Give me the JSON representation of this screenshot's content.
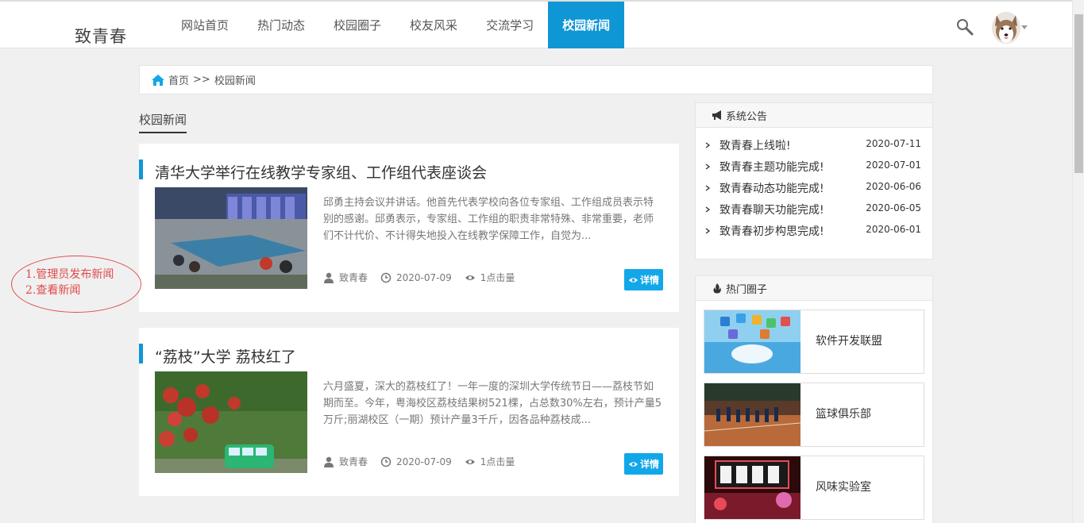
{
  "header": {
    "logo": "致青春",
    "nav": [
      "网站首页",
      "热门动态",
      "校园圈子",
      "校友风采",
      "交流学习",
      "校园新闻"
    ],
    "active_index": 5,
    "accent_color": "#0f96d5"
  },
  "breadcrumb": {
    "home": "首页",
    "separator": ">>",
    "current": "校园新闻"
  },
  "section": {
    "title": "校园新闻"
  },
  "news": [
    {
      "title": "清华大学举行在线教学专家组、工作组代表座谈会",
      "text": "邱勇主持会议并讲话。他首先代表学校向各位专家组、工作组成员表示特别的感谢。邱勇表示，专家组、工作组的职责非常特殊、非常重要，老师们不计代价、不计得失地投入在线教学保障工作，自觉为...",
      "author": "致青春",
      "date": "2020-07-09",
      "views": "1点击量",
      "detail_label": "详情"
    },
    {
      "title": "“荔枝”大学 荔枝红了",
      "text": "六月盛夏，深大的荔枝红了！一年一度的深圳大学传统节日——荔枝节如期而至。今年，粤海校区荔枝结果树521棵，占总数30%左右，预计产量5万斤;丽湖校区（一期）预计产量3千斤，因各品种荔枝成...",
      "author": "致青春",
      "date": "2020-07-09",
      "views": "1点击量",
      "detail_label": "详情"
    }
  ],
  "annotation": {
    "line1": "1.管理员发布新闻",
    "line2": "2.查看新闻"
  },
  "notices": {
    "title": "系统公告",
    "items": [
      {
        "text": "致青春上线啦!",
        "date": "2020-07-11"
      },
      {
        "text": "致青春主题功能完成!",
        "date": "2020-07-01"
      },
      {
        "text": "致青春动态功能完成!",
        "date": "2020-06-06"
      },
      {
        "text": "致青春聊天功能完成!",
        "date": "2020-06-05"
      },
      {
        "text": "致青春初步构思完成!",
        "date": "2020-06-01"
      }
    ]
  },
  "circles": {
    "title": "热门圈子",
    "items": [
      "软件开发联盟",
      "篮球俱乐部",
      "风味实验室"
    ]
  }
}
